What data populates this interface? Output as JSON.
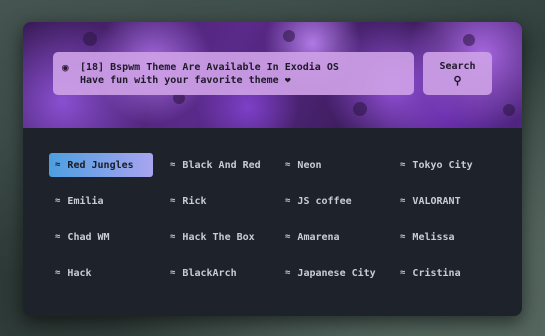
{
  "header": {
    "search_line1": "[18] Bspwm Theme Are Available In Exodia OS",
    "search_line2": "Have fun with your favorite theme ❤",
    "search_button": "Search",
    "search_icon": "palette-icon",
    "button_icon": "magnifier-icon"
  },
  "theme_icon": "wave-icon",
  "accent": "#4d9fe0",
  "themes": [
    {
      "label": "Red Jungles",
      "active": true
    },
    {
      "label": "Black And Red"
    },
    {
      "label": "Neon"
    },
    {
      "label": "Tokyo City"
    },
    {
      "label": "Emilia"
    },
    {
      "label": "Rick"
    },
    {
      "label": "JS coffee"
    },
    {
      "label": "VALORANT"
    },
    {
      "label": "Chad WM"
    },
    {
      "label": "Hack The Box"
    },
    {
      "label": "Amarena"
    },
    {
      "label": "Melissa"
    },
    {
      "label": "Hack"
    },
    {
      "label": "BlackArch"
    },
    {
      "label": "Japanese City"
    },
    {
      "label": "Cristina"
    }
  ]
}
